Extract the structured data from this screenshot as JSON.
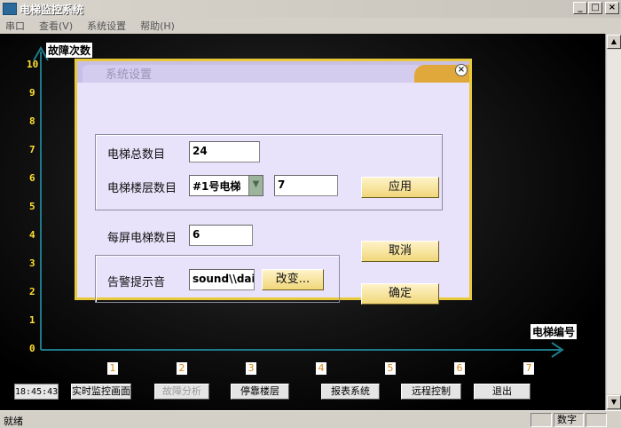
{
  "window": {
    "title": "电梯监控系统"
  },
  "menu": [
    "串口",
    "查看(V)",
    "系统设置",
    "帮助(H)"
  ],
  "chart": {
    "y_axis_title": "故障次数",
    "x_axis_title": "电梯编号",
    "y_ticks": [
      "10",
      "9",
      "8",
      "7",
      "6",
      "5",
      "4",
      "3",
      "2",
      "1",
      "0"
    ],
    "x_ticks": [
      "1",
      "2",
      "3",
      "4",
      "5",
      "6",
      "7"
    ]
  },
  "toolbar": {
    "clock": "18:45:43",
    "buttons": [
      {
        "label": "实时监控画面",
        "enabled": true
      },
      {
        "label": "故障分析",
        "enabled": false
      },
      {
        "label": "停靠楼层",
        "enabled": true
      },
      {
        "label": "报表系统",
        "enabled": true
      },
      {
        "label": "远程控制",
        "enabled": true
      },
      {
        "label": "退出",
        "enabled": true
      }
    ]
  },
  "dialog": {
    "title": "系统设置",
    "total_elevators_label": "电梯总数目",
    "total_elevators_value": "24",
    "floors_label": "电梯楼层数目",
    "elevator_select_value": "#1号电梯",
    "floors_value": "7",
    "apply_label": "应用",
    "per_screen_label": "每屏电梯数目",
    "per_screen_value": "6",
    "cancel_label": "取消",
    "alarm_label": "告警提示音",
    "alarm_value": "sound\\\\daill",
    "change_label": "改变...",
    "ok_label": "确定"
  },
  "statusbar": {
    "text": "就绪",
    "pane_num": "数字"
  }
}
